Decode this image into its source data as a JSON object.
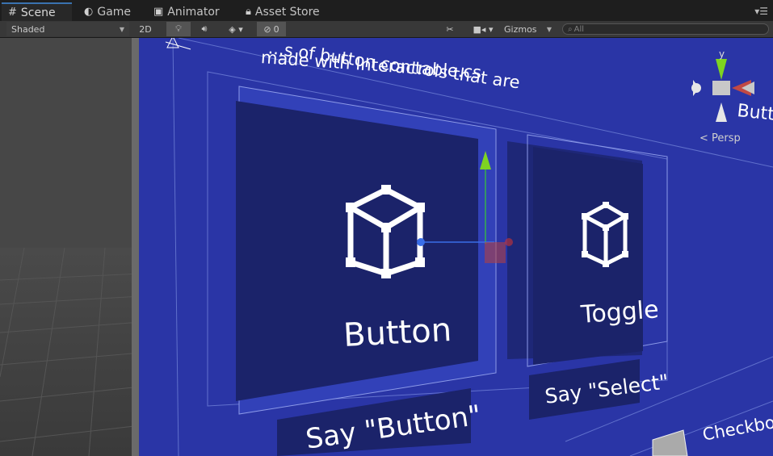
{
  "tabs": [
    {
      "label": "Scene",
      "icon": "scene-grid-icon",
      "active": true
    },
    {
      "label": "Game",
      "icon": "game-pacman-icon",
      "active": false
    },
    {
      "label": "Animator",
      "icon": "animator-icon",
      "active": false
    },
    {
      "label": "Asset Store",
      "icon": "lock-icon",
      "active": false
    }
  ],
  "toolbar": {
    "draw_mode": "Shaded",
    "mode_2d": "2D",
    "hidden_count": "0",
    "gizmos": "Gizmos",
    "search_placeholder": "All"
  },
  "scene": {
    "heading_line1": "...s of button controls that are",
    "heading_line2": "made with Interactable.cs",
    "button_label": "Button",
    "toggle_label": "Toggle",
    "say_button": "Say \"Button\"",
    "say_select": "Say \"Select\"",
    "checkbox_label": "Checkbox Bu",
    "gizmo_axis": "y",
    "gizmo_side_text": "Butto",
    "persp": "Persp"
  },
  "colors": {
    "panel_blue": "#2b36a8",
    "card_dark": "#1a2266",
    "accent_tab": "#3a72b0"
  }
}
